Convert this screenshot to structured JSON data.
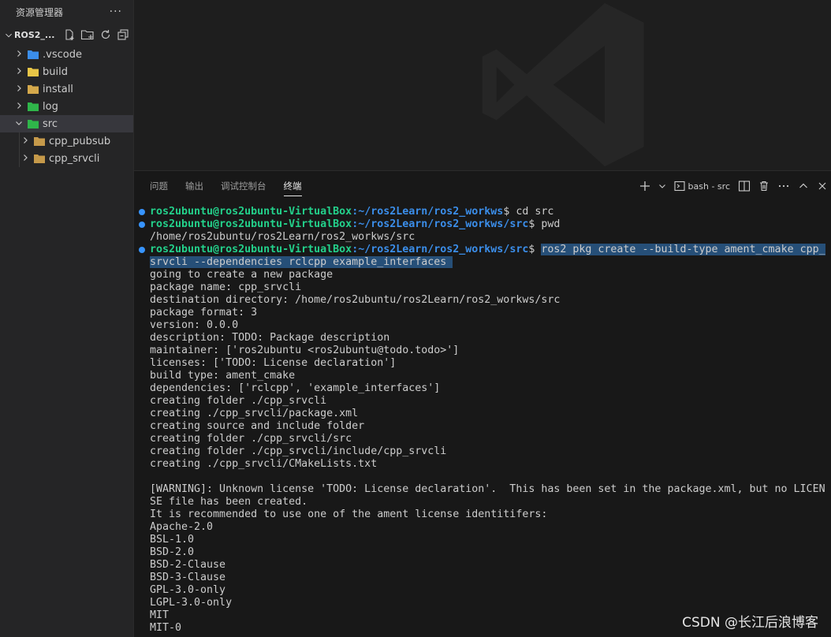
{
  "sidebar": {
    "title": "资源管理器",
    "more": "···",
    "root_label": "ROS2_...",
    "items": [
      {
        "label": ".vscode",
        "icon": "vscode-folder-icon",
        "color": "#3b8eea",
        "expanded": false
      },
      {
        "label": "build",
        "icon": "build-folder-icon",
        "color": "#e8c547",
        "expanded": false
      },
      {
        "label": "install",
        "icon": "folder-icon",
        "color": "#d4a84b",
        "expanded": false
      },
      {
        "label": "log",
        "icon": "log-folder-icon",
        "color": "#2fb54a",
        "expanded": false
      },
      {
        "label": "src",
        "icon": "src-folder-icon",
        "color": "#2fb54a",
        "expanded": true
      },
      {
        "label": "cpp_pubsub",
        "icon": "folder-icon",
        "color": "#c69a4a",
        "expanded": false
      },
      {
        "label": "cpp_srvcli",
        "icon": "folder-icon",
        "color": "#c69a4a",
        "expanded": false
      }
    ]
  },
  "panel": {
    "tabs": [
      "问题",
      "输出",
      "调试控制台",
      "终端"
    ],
    "active_tab": "终端",
    "terminal_name": "bash - src"
  },
  "terminal": {
    "user_host": "ros2ubuntu@ros2ubuntu-VirtualBox",
    "cwd1": ":~/ros2Learn/ros2_workws",
    "cwd2": ":~/ros2Learn/ros2_workws/src",
    "prompt_end": "$ ",
    "cmd1": "cd src",
    "cmd2": "pwd",
    "cmd3_line1": "ros2 pkg create --build-type ament_cmake cpp_",
    "cmd3_line2": "srvcli --dependencies rclcpp example_interfaces ",
    "output": [
      "/home/ros2ubuntu/ros2Learn/ros2_workws/src",
      "going to create a new package",
      "package name: cpp_srvcli",
      "destination directory: /home/ros2ubuntu/ros2Learn/ros2_workws/src",
      "package format: 3",
      "version: 0.0.0",
      "description: TODO: Package description",
      "maintainer: ['ros2ubuntu <ros2ubuntu@todo.todo>']",
      "licenses: ['TODO: License declaration']",
      "build type: ament_cmake",
      "dependencies: ['rclcpp', 'example_interfaces']",
      "creating folder ./cpp_srvcli",
      "creating ./cpp_srvcli/package.xml",
      "creating source and include folder",
      "creating folder ./cpp_srvcli/src",
      "creating folder ./cpp_srvcli/include/cpp_srvcli",
      "creating ./cpp_srvcli/CMakeLists.txt",
      "",
      "[WARNING]: Unknown license 'TODO: License declaration'.  This has been set in the package.xml, but no LICEN",
      "SE file has been created.",
      "It is recommended to use one of the ament license identitifers:",
      "Apache-2.0",
      "BSL-1.0",
      "BSD-2.0",
      "BSD-2-Clause",
      "BSD-3-Clause",
      "GPL-3.0-only",
      "LGPL-3.0-only",
      "MIT",
      "MIT-0"
    ]
  },
  "credit": "CSDN @长江后浪博客"
}
